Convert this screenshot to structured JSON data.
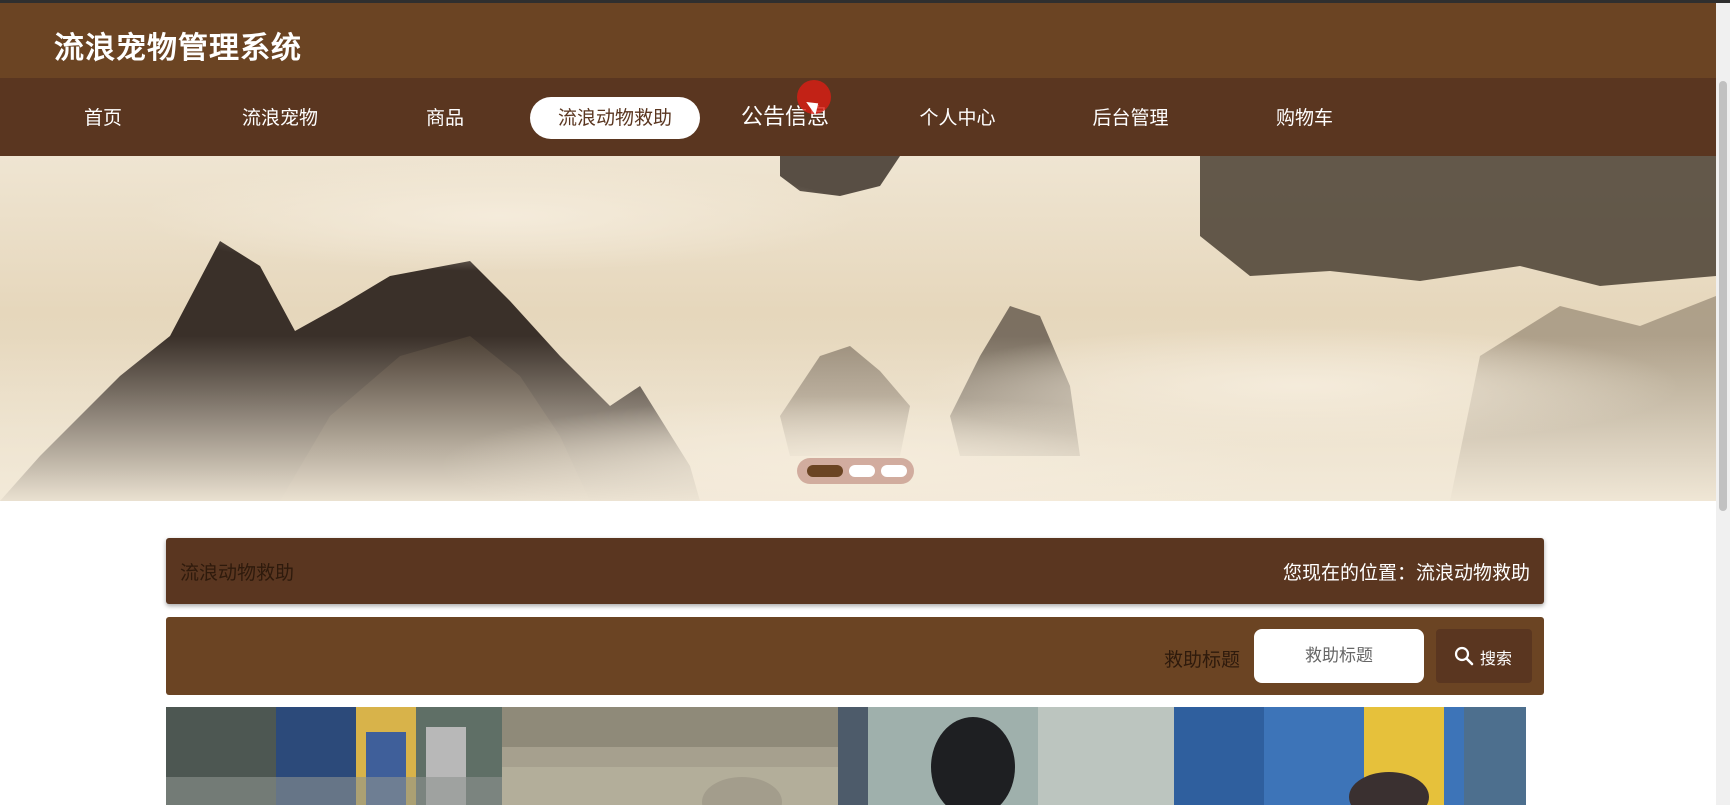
{
  "site": {
    "title": "流浪宠物管理系统"
  },
  "nav": {
    "items": [
      {
        "label": "首页"
      },
      {
        "label": "流浪宠物"
      },
      {
        "label": "商品"
      },
      {
        "label": "流浪动物救助"
      },
      {
        "label": "公告信息"
      },
      {
        "label": "个人中心"
      },
      {
        "label": "后台管理"
      },
      {
        "label": "购物车"
      }
    ],
    "active_index": 3
  },
  "banner": {
    "slides": 3,
    "current": 1
  },
  "section": {
    "title": "流浪动物救助",
    "location": "您现在的位置：流浪动物救助"
  },
  "search": {
    "label": "救助标题",
    "placeholder": "救助标题",
    "value": "",
    "button": "搜索"
  },
  "colors": {
    "header": "#6b4423",
    "nav": "#5a3620",
    "accent": "#ffffff"
  }
}
